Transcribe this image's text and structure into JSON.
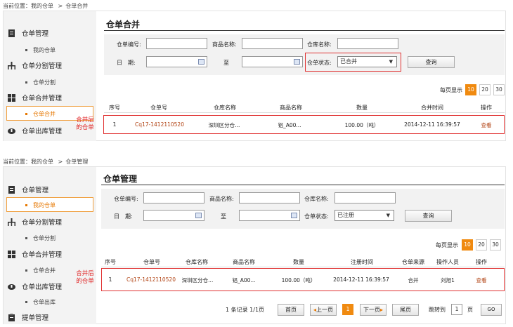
{
  "top": {
    "breadcrumb": {
      "prefix": "当前位置：",
      "parent": "我的仓单",
      "sep": ">",
      "current": "仓单合并"
    },
    "sidebar": {
      "g1": "仓单管理",
      "s1": "我的仓单",
      "g2": "仓单分割管理",
      "s2": "仓单分割",
      "g3": "仓单合并管理",
      "s3": "仓单合并",
      "g4": "仓单出库管理"
    },
    "annotation": "合并后\n的仓单",
    "page_title": "仓单合并",
    "filters": {
      "code_label": "仓单编号:",
      "product_label": "商品名称:",
      "warehouse_label": "仓库名称:",
      "date_label": "日　期:",
      "to_label": "至",
      "status_label": "仓单状态:",
      "status_value": "已合并",
      "query": "查询"
    },
    "page_size": {
      "label": "每页显示",
      "opts": [
        "10",
        "20",
        "30"
      ]
    },
    "headers": [
      "序号",
      "仓单号",
      "仓库名称",
      "商品名称",
      "数量",
      "合并时间",
      "操作"
    ],
    "row": {
      "idx": "1",
      "code": "Cq17-1412110520",
      "warehouse": "深圳区分仓...",
      "product": "铝_A00...",
      "qty": "100.00（吨）",
      "time": "2014-12-11 16:39:57",
      "action": "查看"
    }
  },
  "bottom": {
    "breadcrumb": {
      "prefix": "当前位置：",
      "parent": "我的仓单",
      "sep": ">",
      "current": "仓单管理"
    },
    "sidebar": {
      "g1": "仓单管理",
      "s1": "我的仓单",
      "g2": "仓单分割管理",
      "s2": "仓单分割",
      "g3": "仓单合并管理",
      "s3": "仓单合并",
      "g4": "仓单出库管理",
      "s4": "仓单出库",
      "g5": "提单管理"
    },
    "annotation": "合并后\n的仓单",
    "page_title": "仓单管理",
    "filters": {
      "code_label": "仓单编号:",
      "product_label": "商品名称:",
      "warehouse_label": "仓库名称:",
      "date_label": "日　期:",
      "to_label": "至",
      "status_label": "仓单状态:",
      "status_value": "已注册",
      "query": "查询"
    },
    "page_size": {
      "label": "每页显示",
      "opts": [
        "10",
        "20",
        "30"
      ]
    },
    "headers": [
      "序号",
      "仓单号",
      "仓库名称",
      "商品名称",
      "数量",
      "注册时间",
      "仓单来源",
      "操作人员",
      "操作"
    ],
    "row": {
      "idx": "1",
      "code": "Cq17-1412110520",
      "warehouse": "深圳区分仓...",
      "product": "铝_A00...",
      "qty": "100.00（吨）",
      "time": "2014-12-11 16:39:57",
      "source": "合并",
      "operator": "刘旭1",
      "action": "查看"
    },
    "pager": {
      "records": "1 条记录 1/1页",
      "first": "首页",
      "prev": "上一页",
      "current": "1",
      "next": "下一页",
      "last": "尾页",
      "goto": "跳转到",
      "goto_value": "1",
      "page_unit": "页",
      "go": "GO"
    }
  },
  "colors": {
    "accent": "#f08a10",
    "annotation_red": "#e02020",
    "link": "#b04010"
  }
}
